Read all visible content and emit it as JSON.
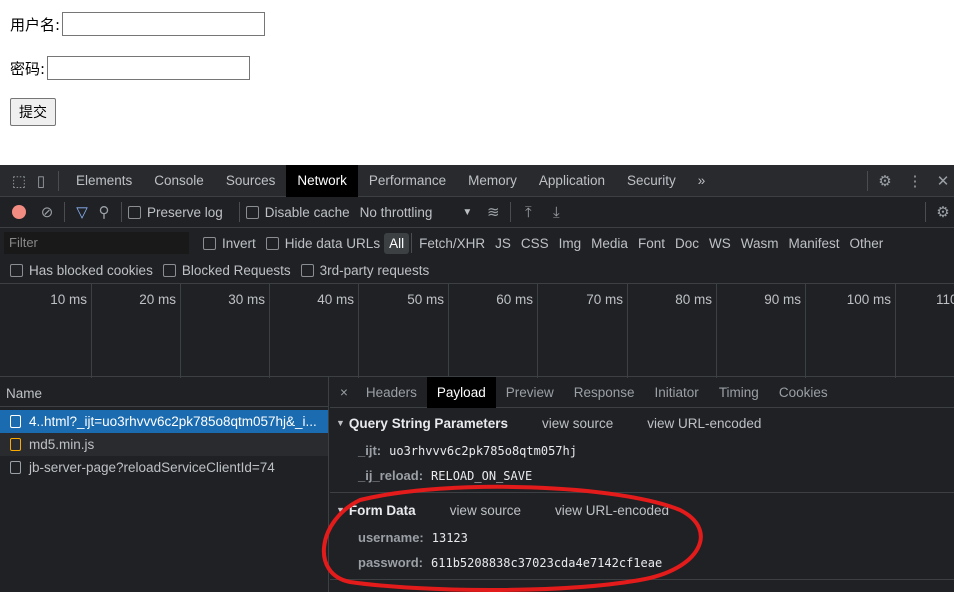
{
  "form": {
    "username_label": "用户名:",
    "password_label": "密码:",
    "submit": "提交"
  },
  "devtools": {
    "tabs": [
      "Elements",
      "Console",
      "Sources",
      "Network",
      "Performance",
      "Memory",
      "Application",
      "Security"
    ],
    "active_tab": "Network",
    "more": "»",
    "toolbar": {
      "preserve_log": "Preserve log",
      "disable_cache": "Disable cache",
      "throttling": "No throttling"
    },
    "filter": {
      "placeholder": "Filter",
      "invert": "Invert",
      "hide_data_urls": "Hide data URLs",
      "types": [
        "All",
        "Fetch/XHR",
        "JS",
        "CSS",
        "Img",
        "Media",
        "Font",
        "Doc",
        "WS",
        "Wasm",
        "Manifest",
        "Other"
      ],
      "active_type": "All",
      "blocked_cookies": "Has blocked cookies",
      "blocked_requests": "Blocked Requests",
      "third_party": "3rd-party requests"
    },
    "timeline_ticks": [
      "10 ms",
      "20 ms",
      "30 ms",
      "40 ms",
      "50 ms",
      "60 ms",
      "70 ms",
      "80 ms",
      "90 ms",
      "100 ms",
      "110"
    ],
    "requests": {
      "header": "Name",
      "items": [
        "4..html?_ijt=uo3rhvvv6c2pk785o8qtm057hj&_i...",
        "md5.min.js",
        "jb-server-page?reloadServiceClientId=74"
      ]
    },
    "detail_tabs": [
      "Headers",
      "Payload",
      "Preview",
      "Response",
      "Initiator",
      "Timing",
      "Cookies"
    ],
    "active_detail_tab": "Payload",
    "query": {
      "title": "Query String Parameters",
      "view_source": "view source",
      "view_url": "view URL-encoded",
      "params": [
        {
          "k": "_ijt:",
          "v": "uo3rhvvv6c2pk785o8qtm057hj"
        },
        {
          "k": "_ij_reload:",
          "v": "RELOAD_ON_SAVE"
        }
      ]
    },
    "form_data": {
      "title": "Form Data",
      "view_source": "view source",
      "view_url": "view URL-encoded",
      "params": [
        {
          "k": "username:",
          "v": "13123"
        },
        {
          "k": "password:",
          "v": "611b5208838c37023cda4e7142cf1eae"
        }
      ]
    },
    "annotation_color": "#e31b1b"
  }
}
